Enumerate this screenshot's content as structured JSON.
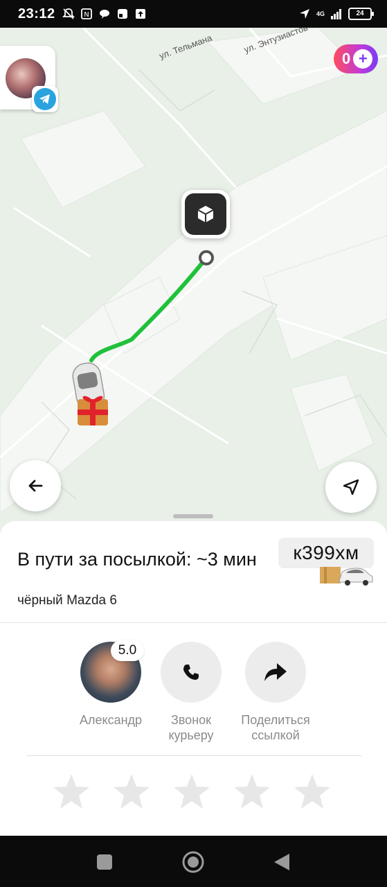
{
  "status_bar": {
    "time": "23:12",
    "network": "4G",
    "battery": "24"
  },
  "map": {
    "streets": [
      "ул. Тельмана",
      "ул. Энтузиастов"
    ],
    "plus_count": "0",
    "route_color": "#1fc13a"
  },
  "order": {
    "status_title": "В пути за посылкой:  ~3 мин",
    "car_description": "чёрный Mazda 6",
    "plate": "к399хм"
  },
  "driver": {
    "name": "Александр",
    "rating": "5.0"
  },
  "actions": [
    {
      "label": "Звонок курьеру"
    },
    {
      "label": "Поделиться ссылкой"
    }
  ],
  "rating_stars_count": 5,
  "icons": {
    "back": "arrow-left-icon",
    "locate": "navigation-arrow-icon",
    "phone": "phone-icon",
    "share": "share-arrow-icon",
    "pickup": "box-icon",
    "telegram": "telegram-icon",
    "plus": "plus-icon"
  }
}
